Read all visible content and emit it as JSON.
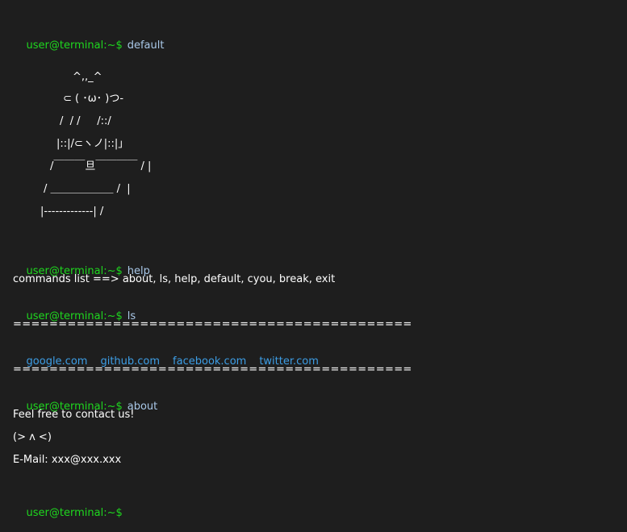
{
  "prompt": "user@terminal:~$",
  "commands": {
    "default": "default",
    "help": "help",
    "ls": "ls",
    "about": "about"
  },
  "ascii_art": [
    "^,,_^",
    "⊂ ( ･ω･ )つ-",
    "/  / /     /::/",
    "|::|/⊂ヽノ|::|」",
    "/￣￣￣旦￣￣￣￣ / |",
    "/ ＿＿＿＿＿＿ /  |",
    "|-------------| /"
  ],
  "help_output": "commands list ==> about, ls, help, default, cyou, break, exit",
  "separator": "============================================",
  "links": [
    {
      "label": "google.com"
    },
    {
      "label": "github.com"
    },
    {
      "label": "facebook.com"
    },
    {
      "label": "twitter.com"
    }
  ],
  "about_output": [
    "Feel free to contact us!",
    "(> ʌ <)",
    "E-Mail: xxx@xxx.xxx"
  ],
  "colors": {
    "background": "#1e1e1e",
    "prompt": "#1ed81e",
    "command": "#a9c8e8",
    "link": "#3d9ee6",
    "text": "#ffffff"
  }
}
